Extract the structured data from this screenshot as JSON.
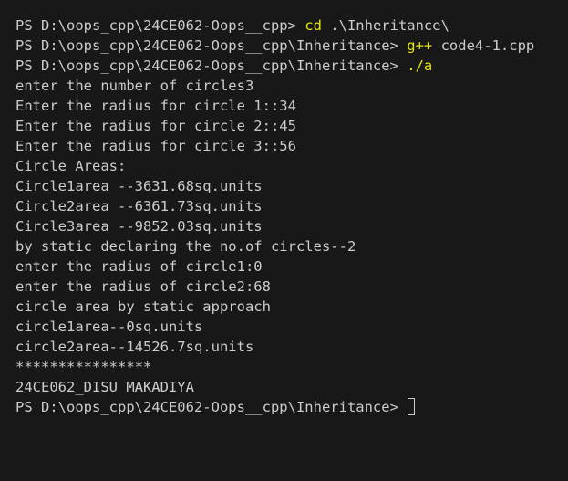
{
  "terminal": {
    "lines": [
      {
        "prompt": "PS D:\\oops_cpp\\24CE062-Oops__cpp> ",
        "command": "cd",
        "args": " .\\Inheritance\\"
      },
      {
        "prompt": "PS D:\\oops_cpp\\24CE062-Oops__cpp\\Inheritance> ",
        "command": "g++",
        "args": " code4-1.cpp"
      },
      {
        "prompt": "PS D:\\oops_cpp\\24CE062-Oops__cpp\\Inheritance> ",
        "command": "./a",
        "args": ""
      },
      {
        "text": "enter the number of circles3"
      },
      {
        "text": "Enter the radius for circle 1::34"
      },
      {
        "text": "Enter the radius for circle 2::45"
      },
      {
        "text": "Enter the radius for circle 3::56"
      },
      {
        "text": "Circle Areas:"
      },
      {
        "text": "Circle1area --3631.68sq.units"
      },
      {
        "text": "Circle2area --6361.73sq.units"
      },
      {
        "text": "Circle3area --9852.03sq.units"
      },
      {
        "text": "by static declaring the no.of circles--2"
      },
      {
        "text": "enter the radius of circle1:0"
      },
      {
        "text": "enter the radius of circle2:68"
      },
      {
        "text": "circle area by static approach"
      },
      {
        "text": "circle1area--0sq.units"
      },
      {
        "text": "circle2area--14526.7sq.units"
      },
      {
        "text": "****************"
      },
      {
        "text": "24CE062_DISU MAKADIYA"
      },
      {
        "prompt": "PS D:\\oops_cpp\\24CE062-Oops__cpp\\Inheritance> ",
        "command": "",
        "args": ""
      }
    ],
    "colors": {
      "background": "#181818",
      "text": "#cccccc",
      "command": "#e5e510"
    }
  }
}
